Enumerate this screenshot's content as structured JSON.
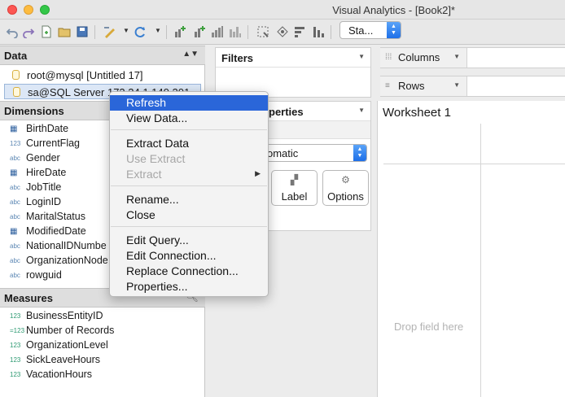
{
  "window": {
    "title": "Visual Analytics - [Book2]*"
  },
  "toolbar": {
    "presentation_select": "Sta..."
  },
  "data_pane": {
    "header": "Data",
    "sources": [
      {
        "label": "root@mysql [Untitled 17]"
      },
      {
        "label": "sa@SQL Server 172.24.1.140.201"
      }
    ]
  },
  "dimensions": {
    "header": "Dimensions",
    "fields": [
      {
        "type": "date",
        "icon_text": "▦",
        "name": "BirthDate"
      },
      {
        "type": "number",
        "icon_text": "123",
        "name": "CurrentFlag"
      },
      {
        "type": "string",
        "icon_text": "abc",
        "name": "Gender"
      },
      {
        "type": "date",
        "icon_text": "▦",
        "name": "HireDate"
      },
      {
        "type": "string",
        "icon_text": "abc",
        "name": "JobTitle"
      },
      {
        "type": "string",
        "icon_text": "abc",
        "name": "LoginID"
      },
      {
        "type": "string",
        "icon_text": "abc",
        "name": "MaritalStatus"
      },
      {
        "type": "datetime",
        "icon_text": "▦",
        "name": "ModifiedDate"
      },
      {
        "type": "string",
        "icon_text": "abc",
        "name": "NationalIDNumbe"
      },
      {
        "type": "string",
        "icon_text": "abc",
        "name": "OrganizationNode"
      },
      {
        "type": "string",
        "icon_text": "abc",
        "name": "rowguid"
      }
    ]
  },
  "measures": {
    "header": "Measures",
    "fields": [
      {
        "icon_text": "123",
        "name": "BusinessEntityID"
      },
      {
        "icon_text": "=123",
        "name": "Number of Records"
      },
      {
        "icon_text": "123",
        "name": "OrganizationLevel"
      },
      {
        "icon_text": "123",
        "name": "SickLeaveHours"
      },
      {
        "icon_text": "123",
        "name": "VacationHours"
      }
    ]
  },
  "filters": {
    "header": "Filters"
  },
  "marks": {
    "header_partial": "perties",
    "mark_type": "omatic",
    "buttons": [
      {
        "label": "Label",
        "icon": "label-icon"
      },
      {
        "label": "Options",
        "icon": "gear-icon"
      }
    ]
  },
  "shelves": {
    "columns": "Columns",
    "rows": "Rows"
  },
  "worksheet": {
    "title": "Worksheet 1",
    "drop_hint": "Drop field here"
  },
  "context_menu": {
    "groups": [
      [
        {
          "label": "Refresh",
          "state": "highlighted"
        },
        {
          "label": "View Data...",
          "state": "enabled"
        }
      ],
      [
        {
          "label": "Extract Data",
          "state": "enabled"
        },
        {
          "label": "Use Extract",
          "state": "disabled"
        },
        {
          "label": "Extract",
          "state": "disabled",
          "submenu": true
        }
      ],
      [
        {
          "label": "Rename...",
          "state": "enabled"
        },
        {
          "label": "Close",
          "state": "enabled"
        }
      ],
      [
        {
          "label": "Edit Query...",
          "state": "enabled"
        },
        {
          "label": "Edit Connection...",
          "state": "enabled"
        },
        {
          "label": "Replace Connection...",
          "state": "enabled"
        },
        {
          "label": "Properties...",
          "state": "enabled"
        }
      ]
    ]
  },
  "colors": {
    "menu_highlight": "#2a66d9",
    "selected_source_bg": "#dce7f6",
    "measure_icon": "#2e9a72"
  }
}
